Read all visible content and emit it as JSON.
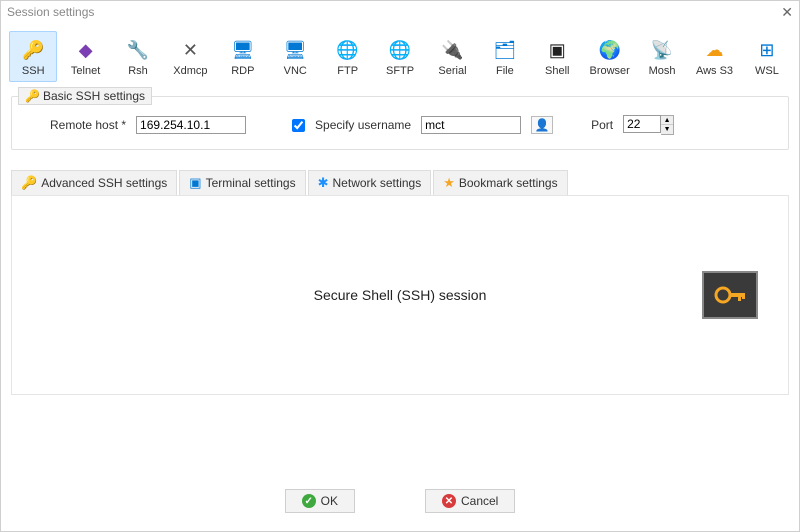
{
  "window": {
    "title": "Session settings"
  },
  "session_types": [
    {
      "label": "SSH",
      "icon": "🔑",
      "active": true
    },
    {
      "label": "Telnet",
      "icon": "◆",
      "active": false
    },
    {
      "label": "Rsh",
      "icon": "🔧",
      "active": false
    },
    {
      "label": "Xdmcp",
      "icon": "✕",
      "active": false
    },
    {
      "label": "RDP",
      "icon": "🖥",
      "active": false
    },
    {
      "label": "VNC",
      "icon": "🖥",
      "active": false
    },
    {
      "label": "FTP",
      "icon": "🌐",
      "active": false
    },
    {
      "label": "SFTP",
      "icon": "🌐",
      "active": false
    },
    {
      "label": "Serial",
      "icon": "🔌",
      "active": false
    },
    {
      "label": "File",
      "icon": "🗂",
      "active": false
    },
    {
      "label": "Shell",
      "icon": "▣",
      "active": false
    },
    {
      "label": "Browser",
      "icon": "🌍",
      "active": false
    },
    {
      "label": "Mosh",
      "icon": "📡",
      "active": false
    },
    {
      "label": "Aws S3",
      "icon": "☁",
      "active": false
    },
    {
      "label": "WSL",
      "icon": "⊞",
      "active": false
    }
  ],
  "basic_group": {
    "legend": "Basic SSH settings",
    "remote_host_label": "Remote host *",
    "remote_host_value": "169.254.10.1",
    "specify_username_label": "Specify username",
    "specify_username_checked": true,
    "username_value": "mct",
    "port_label": "Port",
    "port_value": "22"
  },
  "tabs": [
    {
      "label": "Advanced SSH settings",
      "icon": "🔑"
    },
    {
      "label": "Terminal settings",
      "icon": "▣"
    },
    {
      "label": "Network settings",
      "icon": "✱"
    },
    {
      "label": "Bookmark settings",
      "icon": "★"
    }
  ],
  "panel": {
    "title": "Secure Shell (SSH) session"
  },
  "buttons": {
    "ok": "OK",
    "cancel": "Cancel"
  }
}
